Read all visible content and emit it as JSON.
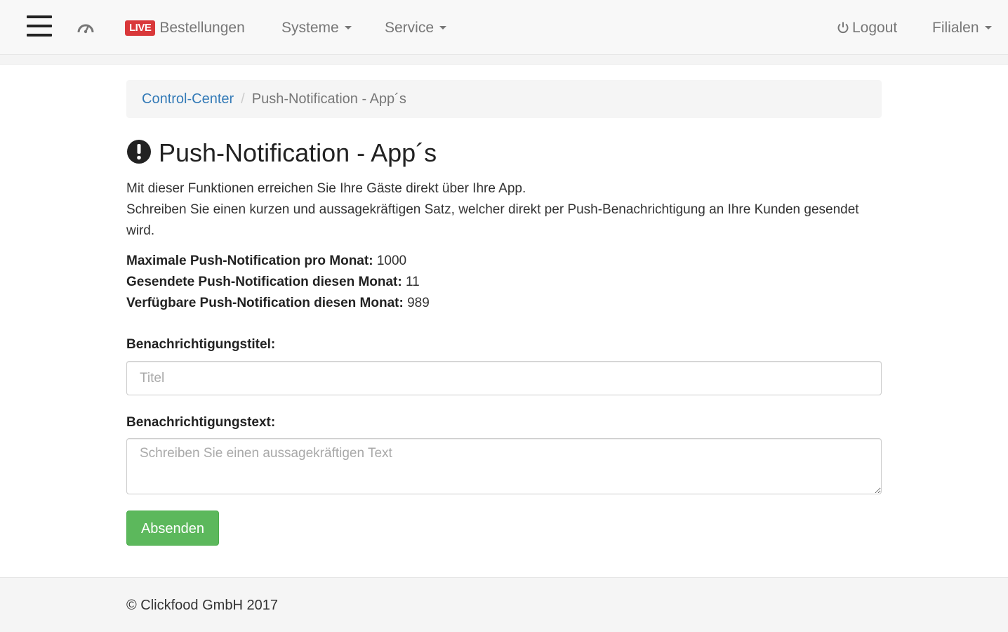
{
  "navbar": {
    "menu_icon": "hamburger-menu-icon",
    "dashboard_icon": "dashboard-icon",
    "live_badge": "LIVE",
    "orders_label": "Bestellungen",
    "systems_label": "Systeme",
    "service_label": "Service",
    "logout_icon": "power-icon",
    "logout_label": "Logout",
    "branches_label": "Filialen"
  },
  "breadcrumb": {
    "items": [
      {
        "label": "Control-Center",
        "active": false
      },
      {
        "label": "Push-Notification - App´s",
        "active": true
      }
    ],
    "separator": "/"
  },
  "page": {
    "title_icon": "exclamation-circle-icon",
    "title": "Push-Notification - App´s",
    "description_line1": "Mit dieser Funktionen erreichen Sie Ihre Gäste direkt über Ihre App.",
    "description_line2": "Schreiben Sie einen kurzen und aussagekräftigen Satz, welcher direkt per Push-Benachrichtigung an Ihre Kunden gesendet wird."
  },
  "stats": [
    {
      "label": "Maximale Push-Notification pro Monat:",
      "value": "1000"
    },
    {
      "label": "Gesendete Push-Notification diesen Monat:",
      "value": "11"
    },
    {
      "label": "Verfügbare Push-Notification diesen Monat:",
      "value": "989"
    }
  ],
  "form": {
    "title_label": "Benachrichtigungstitel:",
    "title_placeholder": "Titel",
    "title_value": "",
    "text_label": "Benachrichtigungstext:",
    "text_placeholder": "Schreiben Sie einen aussagekräftigen Text",
    "text_value": "",
    "submit_label": "Absenden"
  },
  "colors": {
    "accent_link": "#337ab7",
    "live_badge": "#d9383a",
    "submit_button": "#5cb85c"
  },
  "footer": {
    "copyright": "© Clickfood GmbH 2017"
  }
}
